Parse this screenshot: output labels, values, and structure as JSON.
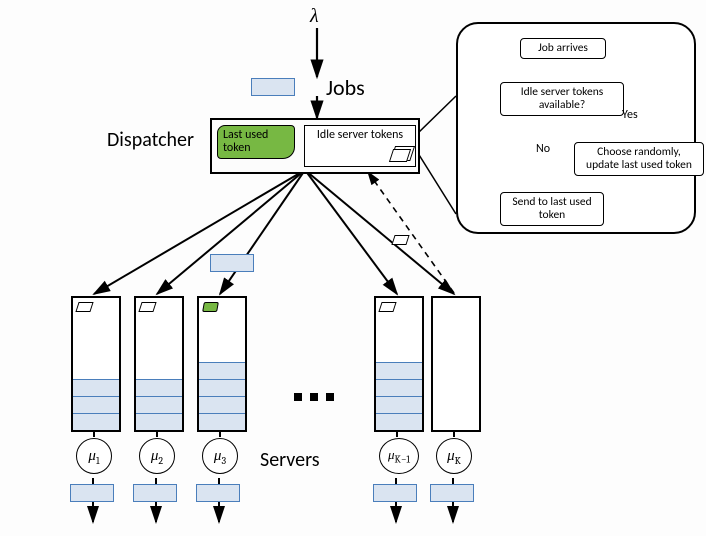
{
  "arrival_rate_symbol": "λ",
  "jobs_label": "Jobs",
  "dispatcher_label": "Dispatcher",
  "servers_label": "Servers",
  "dispatcher": {
    "last_used_token": "Last used token",
    "idle_server_tokens": "Idle server tokens"
  },
  "flowchart": {
    "job_arrives": "Job arrives",
    "idle_available": "Idle server tokens available?",
    "yes": "Yes",
    "no": "No",
    "choose_randomly": "Choose randomly, update last used token",
    "send_last": "Send to last used token"
  },
  "servers": {
    "mu_labels": [
      "μ₁",
      "μ₂",
      "μ₃",
      "μ_{K-1}",
      "μ_K"
    ],
    "queue_levels": [
      3,
      3,
      4,
      4,
      0
    ],
    "count_symbol": "K"
  }
}
